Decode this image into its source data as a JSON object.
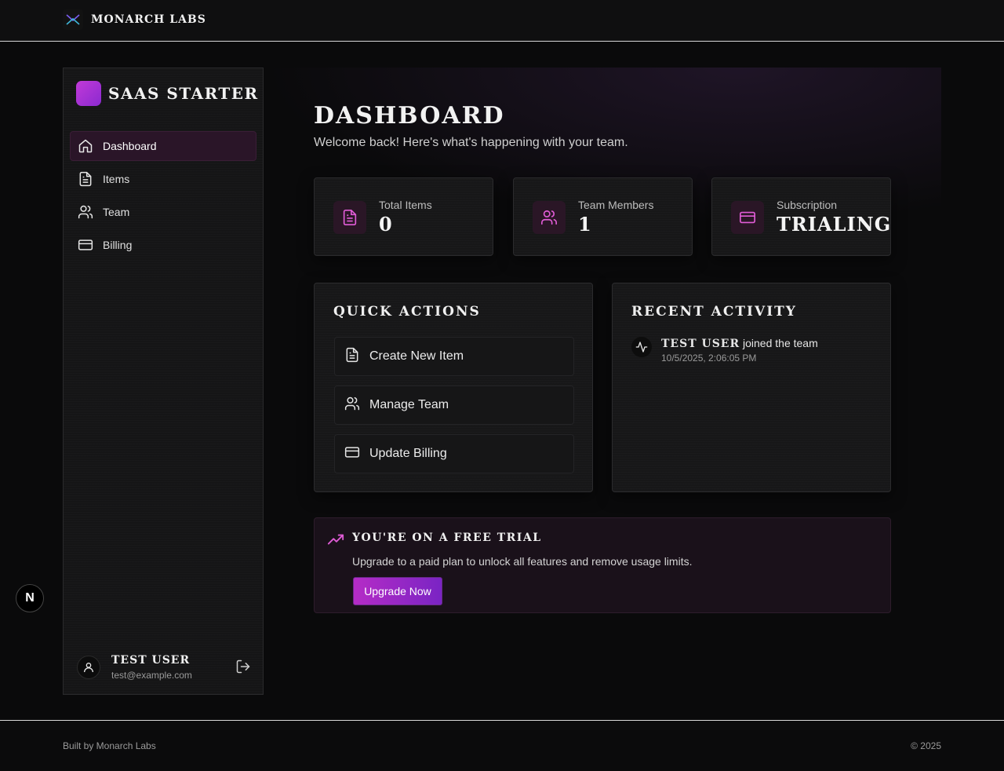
{
  "topbar": {
    "brand": "MONARCH LABS",
    "logo_icon": "monarch-logo-icon"
  },
  "sidebar": {
    "title": "SAAS STARTER",
    "items": [
      {
        "label": "Dashboard",
        "icon": "home-icon",
        "active": true
      },
      {
        "label": "Items",
        "icon": "document-icon"
      },
      {
        "label": "Team",
        "icon": "users-icon"
      },
      {
        "label": "Billing",
        "icon": "credit-card-icon"
      }
    ],
    "user": {
      "name": "TEST USER",
      "email": "test@example.com"
    }
  },
  "page": {
    "title": "DASHBOARD",
    "subtitle": "Welcome back! Here's what's happening with your team."
  },
  "stats": [
    {
      "label": "Total Items",
      "value": "0",
      "icon": "document-icon"
    },
    {
      "label": "Team Members",
      "value": "1",
      "icon": "users-icon"
    },
    {
      "label": "Subscription",
      "value": "TRIALING",
      "icon": "credit-card-icon"
    }
  ],
  "quick_actions": {
    "title": "QUICK ACTIONS",
    "items": [
      {
        "label": "Create New Item",
        "icon": "document-icon"
      },
      {
        "label": "Manage Team",
        "icon": "users-icon"
      },
      {
        "label": "Update Billing",
        "icon": "credit-card-icon"
      }
    ]
  },
  "activity": {
    "title": "RECENT ACTIVITY",
    "items": [
      {
        "user": "TEST USER",
        "action": " joined the team",
        "time": "10/5/2025, 2:06:05 PM",
        "icon": "activity-icon"
      }
    ]
  },
  "trial": {
    "title": "YOU'RE ON A FREE TRIAL",
    "description": "Upgrade to a paid plan to unlock all features and remove usage limits.",
    "button": "Upgrade Now",
    "icon": "trending-up-icon"
  },
  "fab": {
    "label": "N"
  },
  "footer": {
    "left": "Built by Monarch Labs",
    "right": "© 2025"
  },
  "colors": {
    "accent": "#c13ad8",
    "accent_dark": "#7a24c4",
    "background": "#0b0b0c",
    "icon_pink": "#e05cd6"
  }
}
